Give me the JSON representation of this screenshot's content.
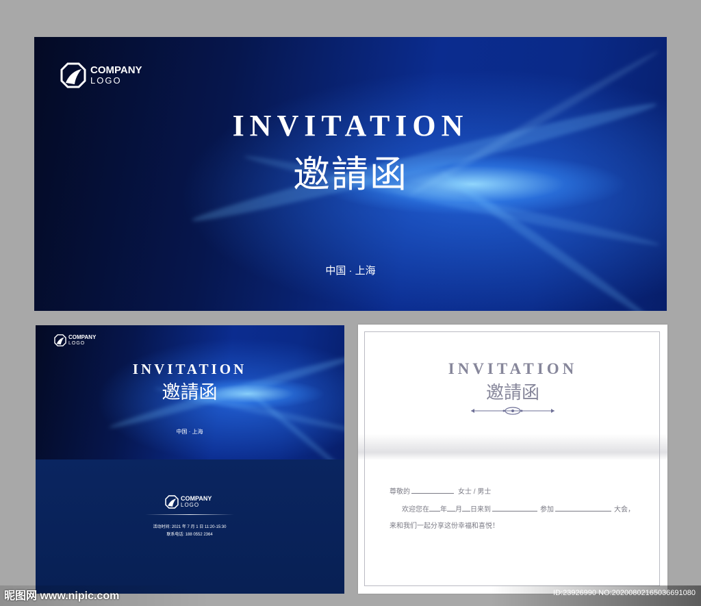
{
  "cover": {
    "logo_line1": "COMPANY",
    "logo_line2": "LOGO",
    "title": "INVITATION",
    "subtitle": "邀請函",
    "location": "中国 · 上海"
  },
  "card_left": {
    "logo_line1": "COMPANY",
    "logo_line2": "LOGO",
    "title": "INVITATION",
    "subtitle": "邀請函",
    "location": "中国 · 上海",
    "back_logo_line1": "COMPANY",
    "back_logo_line2": "LOGO",
    "event_time": "活动时间: 2021 年 7 月 1 日 11:20-15:30",
    "contact": "联系电话: 188 0552 2364"
  },
  "card_right": {
    "title": "INVITATION",
    "subtitle": "邀請函",
    "line1_prefix": "尊敬的",
    "line1_suffix": "女士 / 男士",
    "line2_a": "欢迎您在",
    "line2_b": "年",
    "line2_c": "月",
    "line2_d": "日来到",
    "line2_e": "参加",
    "line2_f": "大会，",
    "line3": "来和我们一起分享这份幸福和喜悦！"
  },
  "watermark": {
    "site": "昵图网 www.nipic.com",
    "id_text": "ID:23926990 NO:20200802165036691080"
  },
  "colors": {
    "page_bg": "#a8a8a8",
    "cover_dark": "#040a24",
    "cover_blue": "#0b2c8f",
    "back_navy": "#0a2560",
    "letter_text": "#7a7a84"
  }
}
